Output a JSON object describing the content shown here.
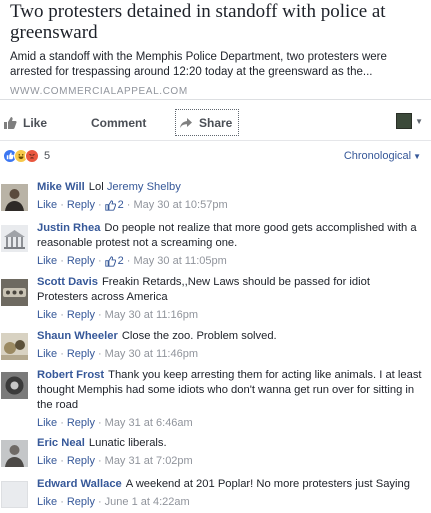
{
  "link": {
    "title": "Two protesters detained in standoff with police at greensward",
    "description": "Amid a standoff with the Memphis Police Department, two protesters were arrested for trespassing around 12:20 today at the greensward as the...",
    "domain": "WWW.COMMERCIALAPPEAL.COM"
  },
  "actions": {
    "like_label": "Like",
    "comment_label": "Comment",
    "share_label": "Share"
  },
  "summary": {
    "reaction_count": "5",
    "order_label": "Chronological",
    "reactions": [
      "like-icon",
      "haha-icon",
      "angry-icon"
    ]
  },
  "comments": [
    {
      "name": "Mike Will",
      "text": "Lol",
      "tag": "Jeremy Shelby",
      "like_label": "Like",
      "reply_label": "Reply",
      "likes": "2",
      "time": "May 30 at 10:57pm"
    },
    {
      "name": "Justin Rhea",
      "text": "Do people not realize that more good gets accomplished with a reasonable protest not a screaming one.",
      "tag": "",
      "like_label": "Like",
      "reply_label": "Reply",
      "likes": "2",
      "time": "May 30 at 11:05pm"
    },
    {
      "name": "Scott Davis",
      "text": "Freakin Retards,,New Laws should be passed for idiot Protesters across America",
      "tag": "",
      "like_label": "Like",
      "reply_label": "Reply",
      "likes": "",
      "time": "May 30 at 11:16pm"
    },
    {
      "name": "Shaun Wheeler",
      "text": "Close the zoo. Problem solved.",
      "tag": "",
      "like_label": "Like",
      "reply_label": "Reply",
      "likes": "",
      "time": "May 30 at 11:46pm"
    },
    {
      "name": "Robert Frost",
      "text": "Thank you keep arresting them for acting like animals. I at least thought Memphis had some idiots who don't wanna get run over for sitting in the road",
      "tag": "",
      "like_label": "Like",
      "reply_label": "Reply",
      "likes": "",
      "time": "May 31 at 6:46am"
    },
    {
      "name": "Eric Neal",
      "text": "Lunatic liberals.",
      "tag": "",
      "like_label": "Like",
      "reply_label": "Reply",
      "likes": "",
      "time": "May 31 at 7:02pm"
    },
    {
      "name": "Edward Wallace",
      "text": "A weekend at 201 Poplar! No more protesters just Saying",
      "tag": "",
      "like_label": "Like",
      "reply_label": "Reply",
      "likes": "",
      "time": "June 1 at 4:22am"
    }
  ],
  "colors": {
    "link_blue": "#365899",
    "meta_gray": "#90949c",
    "text": "#1d2129"
  }
}
